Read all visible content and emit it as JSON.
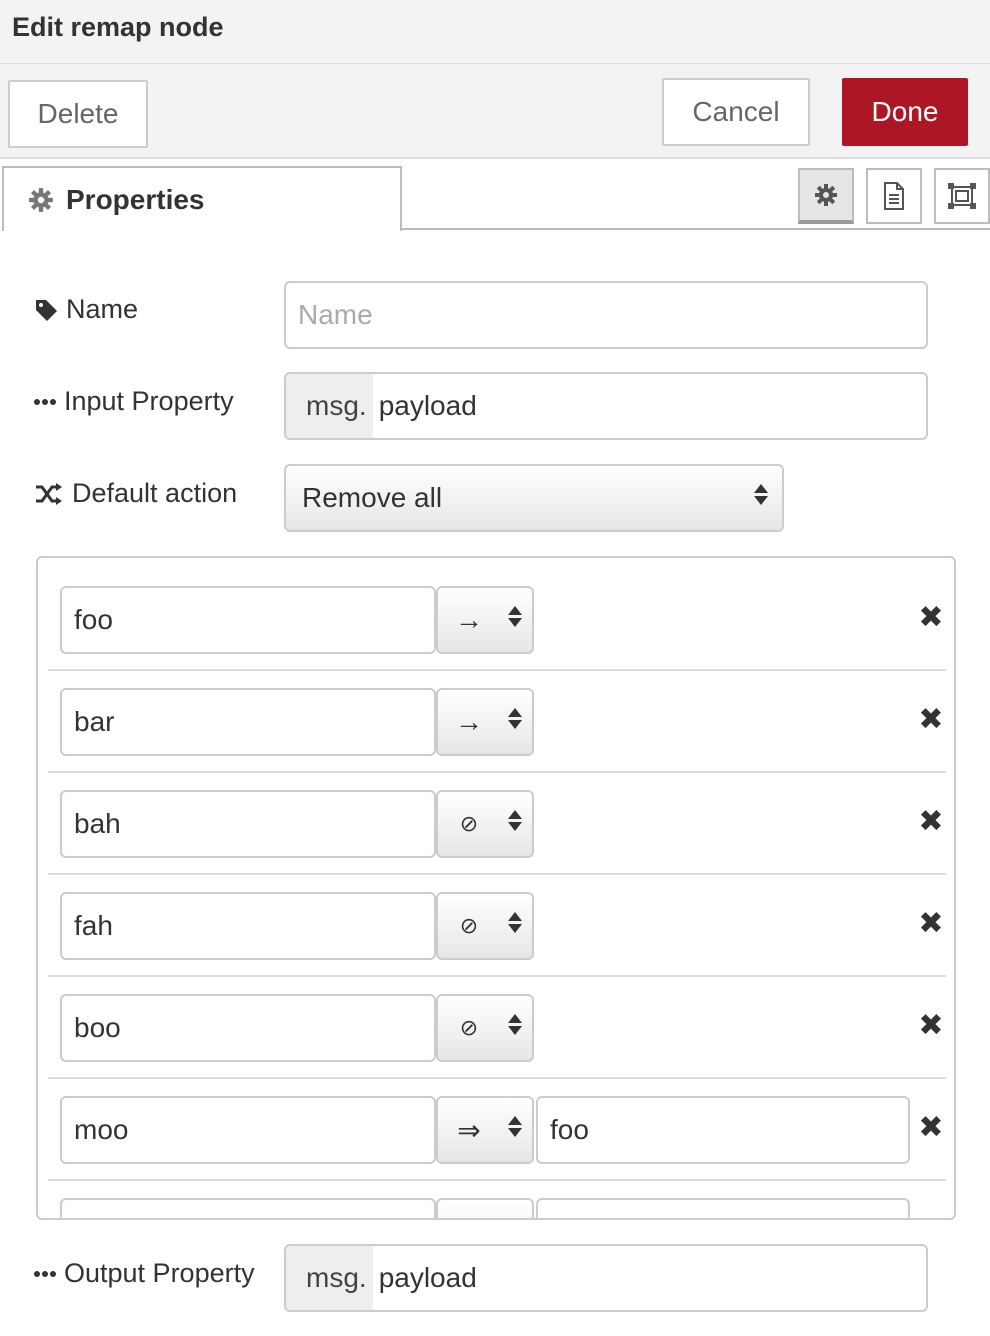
{
  "dialog": {
    "title": "Edit remap node"
  },
  "toolbar": {
    "delete_label": "Delete",
    "cancel_label": "Cancel",
    "done_label": "Done",
    "done_color": "#ad1625"
  },
  "tabs": {
    "properties_label": "Properties",
    "properties_icon": "gear-icon",
    "buttons": [
      "gear-icon",
      "document-icon",
      "frame-icon"
    ]
  },
  "form": {
    "name_label": "Name",
    "name_placeholder": "Name",
    "name_value": "",
    "input_property_label": "Input Property",
    "input_property_type": "msg.",
    "input_property_value": "payload",
    "default_action_label": "Default action",
    "default_action_value": "Remove all",
    "output_property_label": "Output Property",
    "output_property_type": "msg.",
    "output_property_value": "payload"
  },
  "rules": [
    {
      "from": "foo",
      "op": "→",
      "op_name": "keep-arrow-icon",
      "to": null
    },
    {
      "from": "bar",
      "op": "→",
      "op_name": "keep-arrow-icon",
      "to": null
    },
    {
      "from": "bah",
      "op": "⊘",
      "op_name": "remove-icon",
      "to": null
    },
    {
      "from": "fah",
      "op": "⊘",
      "op_name": "remove-icon",
      "to": null
    },
    {
      "from": "boo",
      "op": "⊘",
      "op_name": "remove-icon",
      "to": null
    },
    {
      "from": "moo",
      "op": "⇒",
      "op_name": "rename-arrow-icon",
      "to": "foo"
    }
  ]
}
